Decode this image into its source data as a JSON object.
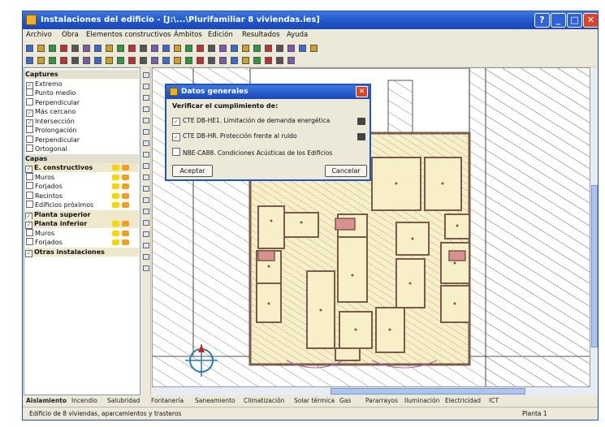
{
  "window": {
    "title": "Instalaciones del edificio - [J:\\...\\Plurifamiliar 8 viviendas.ies]",
    "buttons": [
      "?",
      "_",
      "□",
      "✕"
    ]
  },
  "menu": [
    "Archivo",
    "Obra",
    "Elementos constructivos",
    "Ámbitos",
    "Edición",
    "Resultados",
    "Ayuda"
  ],
  "left_panel": {
    "sections": [
      {
        "label": "Captures",
        "type": "header"
      },
      {
        "label": "Extremo",
        "checked": true
      },
      {
        "label": "Punto medio",
        "checked": false
      },
      {
        "label": "Perpendicular",
        "checked": false
      },
      {
        "label": "Más cercano",
        "checked": true
      },
      {
        "label": "Intersección",
        "checked": true
      },
      {
        "label": "Prolongación",
        "checked": false
      },
      {
        "label": "Perpendicular",
        "checked": false
      },
      {
        "label": "Ortogonal",
        "checked": false
      },
      {
        "label": "Capas",
        "type": "header"
      },
      {
        "label": "E. constructivos",
        "bold": true
      },
      {
        "label": "Muros"
      },
      {
        "label": "Forjados"
      },
      {
        "label": "Recintos"
      },
      {
        "label": "Edificios próximos"
      },
      {
        "label": "Planta superior",
        "bold": true
      },
      {
        "label": "Planta inferior",
        "bold": true
      },
      {
        "label": "Muros"
      },
      {
        "label": "Forjados"
      },
      {
        "label": "Otras instalaciones",
        "bold": true
      }
    ]
  },
  "dialog": {
    "title": "Datos generales",
    "prompt": "Verificar el cumplimiento de:",
    "options": [
      {
        "label": "CTE DB-HE1. Limitación de demanda energética",
        "checked": true
      },
      {
        "label": "CTE DB-HR. Protección frente al ruido",
        "checked": true
      },
      {
        "label": "NBE-CA88. Condiciones Acústicas de los Edificios",
        "checked": false
      }
    ],
    "accept_label": "Aceptar",
    "cancel_label": "Cancelar"
  },
  "tabs": [
    "Aislamiento",
    "Incendio",
    "Salubridad",
    "Fontanería",
    "Saneamiento",
    "Climatización",
    "Solar térmica",
    "Gas",
    "Pararrayos",
    "Iluminación",
    "Electricidad",
    "ICT"
  ],
  "status": {
    "left": "Edificio de 8 viviendas, aparcamientos y trasteros",
    "right": "Planta 1"
  },
  "colors": {
    "titlebar": "#1f54c8",
    "room_fill": "#f6efc8",
    "wall": "#7a5a48",
    "hatch": "#8a8a8a",
    "accent_orange": "#f0a020",
    "accent_yellow": "#f4d800"
  }
}
